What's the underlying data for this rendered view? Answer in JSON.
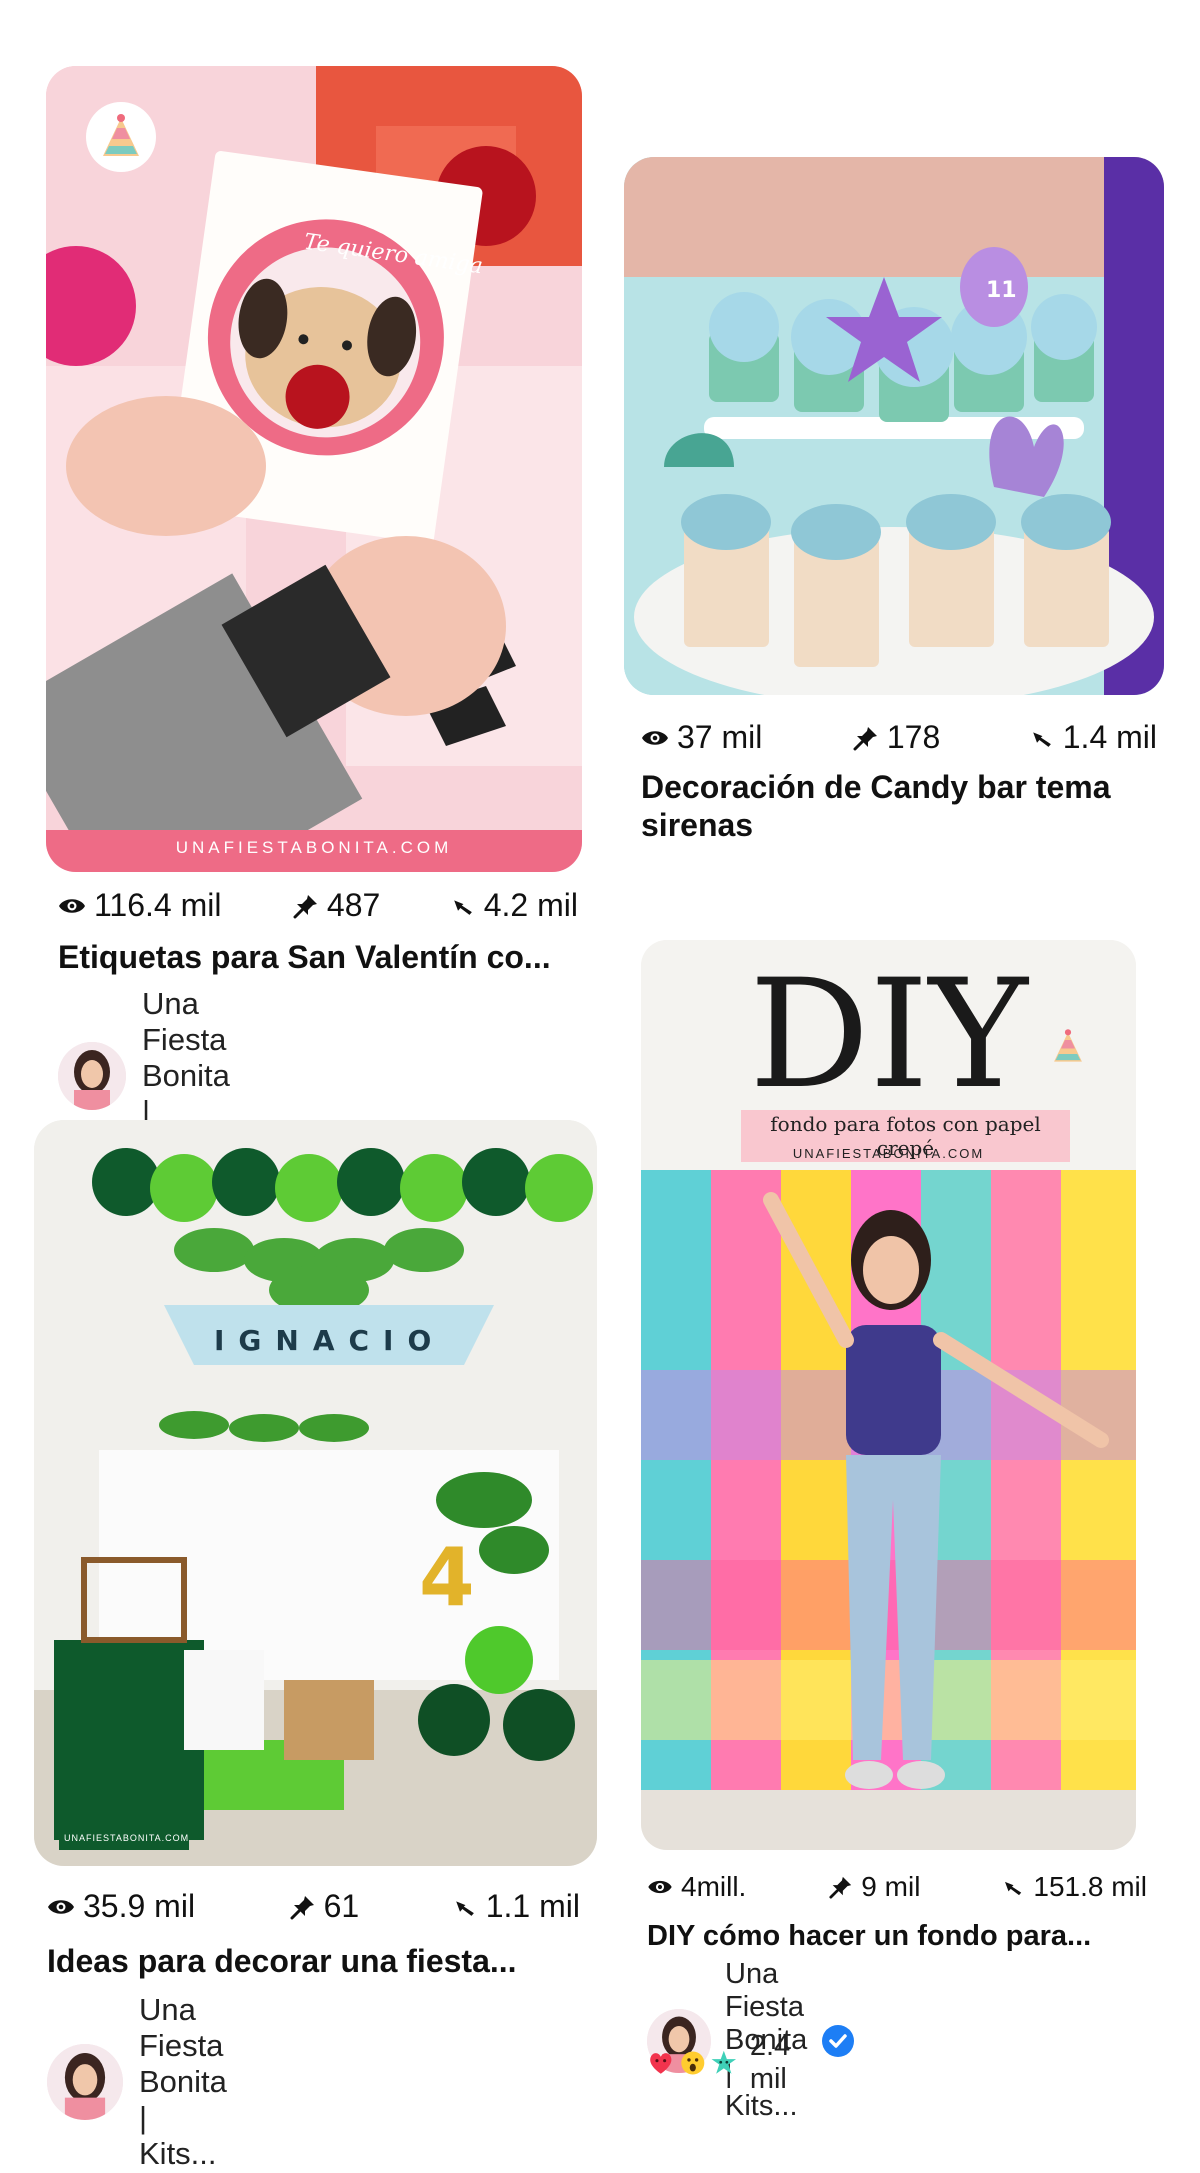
{
  "cards": [
    {
      "image": "valentine-cards-photo",
      "watermark": "UNAFIESTABONITA.COM",
      "card_text": "Te quiero amiga",
      "views": "116.4 mil",
      "pins": "487",
      "clicks": "4.2 mil",
      "title": "Etiquetas para San Valentín co...",
      "author": "Una Fiesta Bonita | Kits..."
    },
    {
      "image": "mermaid-cupcakes-photo",
      "views": "37 mil",
      "pins": "178",
      "clicks": "1.4 mil",
      "title_line1": "Decoración de Candy bar tema",
      "title_line2": "sirenas"
    },
    {
      "image": "jungle-party-table-photo",
      "banner": "IGNACIO",
      "watermark": "UNAFIESTABONITA.COM",
      "views": "35.9 mil",
      "pins": "61",
      "clicks": "1.1 mil",
      "title": "Ideas para decorar una fiesta...",
      "author": "Una Fiesta Bonita | Kits..."
    },
    {
      "image": "diy-crepe-backdrop-photo",
      "headline": "DIY",
      "subheadline": "fondo para fotos con papel crepé",
      "site": "UNAFIESTABONITA.COM",
      "views": "4mill.",
      "pins": "9 mil",
      "clicks": "151.8 mil",
      "title": "DIY cómo hacer un fondo para...",
      "author": "Una Fiesta Bonita | Kits...",
      "reactions_count": "2.4 mil"
    }
  ],
  "colors": {
    "text": "#111111",
    "verified": "#1d7ef5",
    "card_pink": "#ee6b86"
  }
}
